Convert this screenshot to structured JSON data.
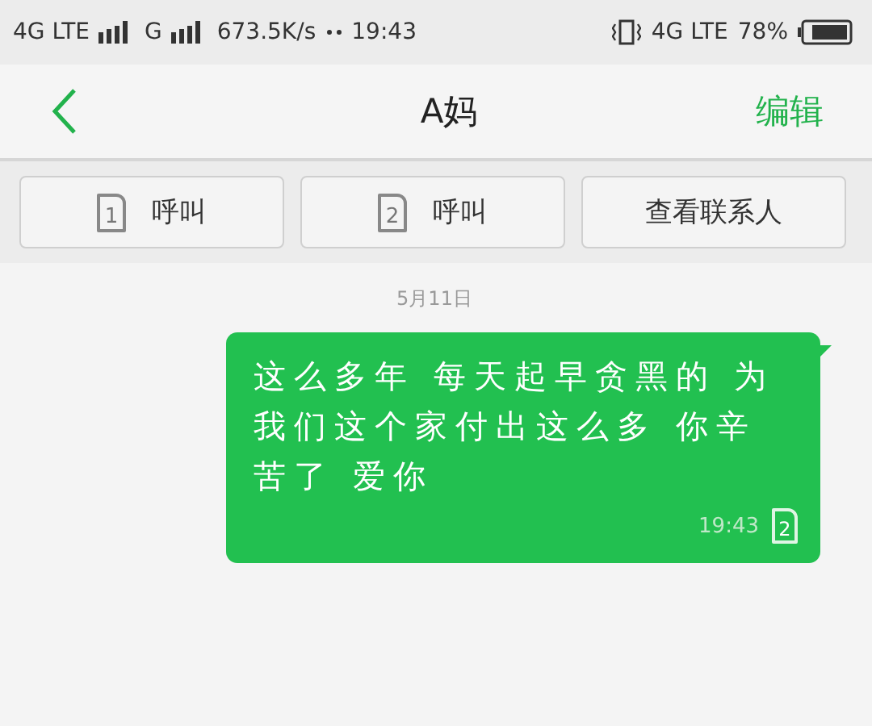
{
  "status_bar": {
    "network_1": "4G LTE",
    "network_2": "G",
    "speed": "673.5K/s",
    "time": "19:43",
    "network_3": "4G LTE",
    "battery": "78%"
  },
  "header": {
    "title": "A妈",
    "action": "编辑"
  },
  "actions": [
    {
      "kind": "sim",
      "sim": "1",
      "label": "呼叫"
    },
    {
      "kind": "sim",
      "sim": "2",
      "label": "呼叫"
    },
    {
      "kind": "plain",
      "label": "查看联系人"
    }
  ],
  "date": "5月11日",
  "messages": [
    {
      "text": "这么多年 每天起早贪黑的 为我们这个家付出这么多 你辛苦了 爱你",
      "time": "19:43",
      "sim": "2"
    }
  ]
}
